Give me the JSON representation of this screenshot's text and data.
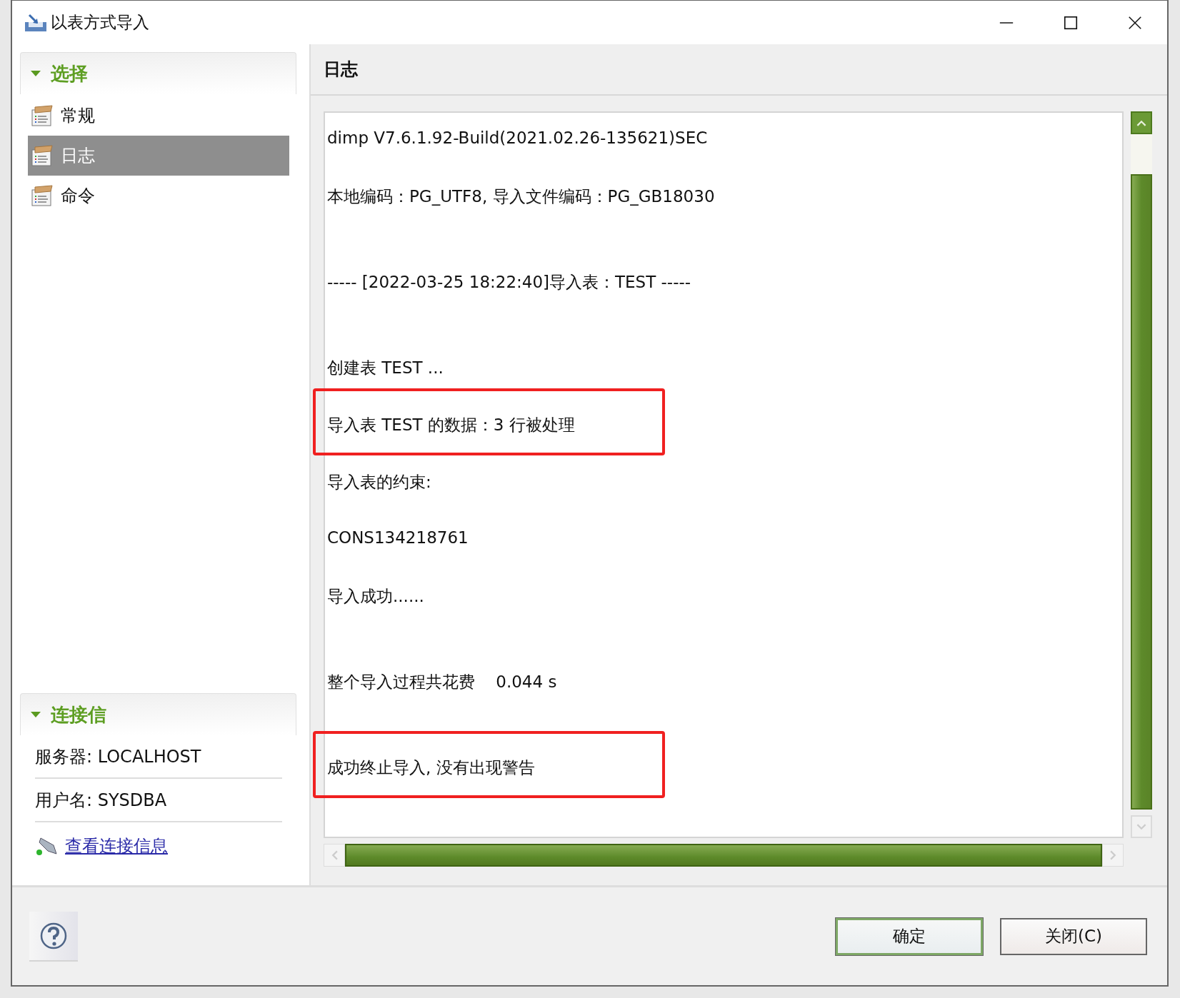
{
  "window": {
    "title": "以表方式导入",
    "controls": [
      {
        "kind": "minimize"
      },
      {
        "kind": "maximize"
      },
      {
        "kind": "close"
      }
    ]
  },
  "sidebar": {
    "sections": [
      {
        "title": "选择",
        "expanded": true,
        "items": [
          {
            "label": "常规",
            "selected": false
          },
          {
            "label": "日志",
            "selected": true
          },
          {
            "label": "命令",
            "selected": false
          }
        ]
      }
    ],
    "connection": {
      "title": "连接信",
      "expanded": true,
      "rows": [
        "服务器: LOCALHOST",
        "用户名: SYSDBA"
      ],
      "link": "查看连接信息"
    }
  },
  "panel": {
    "title": "日志",
    "log": [
      {
        "text": "dimp V7.6.1.92-Build(2021.02.26-135621)SEC",
        "gap_before": false,
        "highlighted": false
      },
      {
        "text": "本地编码：PG_UTF8, 导入文件编码：PG_GB18030",
        "gap_before": false,
        "highlighted": false
      },
      {
        "text": "----- [2022-03-25 18:22:40]导入表：TEST -----",
        "gap_before": true,
        "highlighted": false
      },
      {
        "text": "创建表 TEST ...",
        "gap_before": true,
        "highlighted": false
      },
      {
        "text": "导入表 TEST 的数据：3 行被处理",
        "gap_before": false,
        "highlighted": true
      },
      {
        "text": "导入表的约束:",
        "gap_before": false,
        "highlighted": false
      },
      {
        "text": "CONS134218761",
        "gap_before": false,
        "highlighted": false
      },
      {
        "text": "导入成功......",
        "gap_before": false,
        "highlighted": false
      },
      {
        "text": "整个导入过程共花费    0.044 s",
        "gap_before": true,
        "highlighted": false
      },
      {
        "text": "成功终止导入, 没有出现警告",
        "gap_before": true,
        "highlighted": true
      }
    ]
  },
  "buttons": [
    {
      "label": "确定",
      "default": true
    },
    {
      "label": "关闭(C)",
      "default": false
    }
  ]
}
